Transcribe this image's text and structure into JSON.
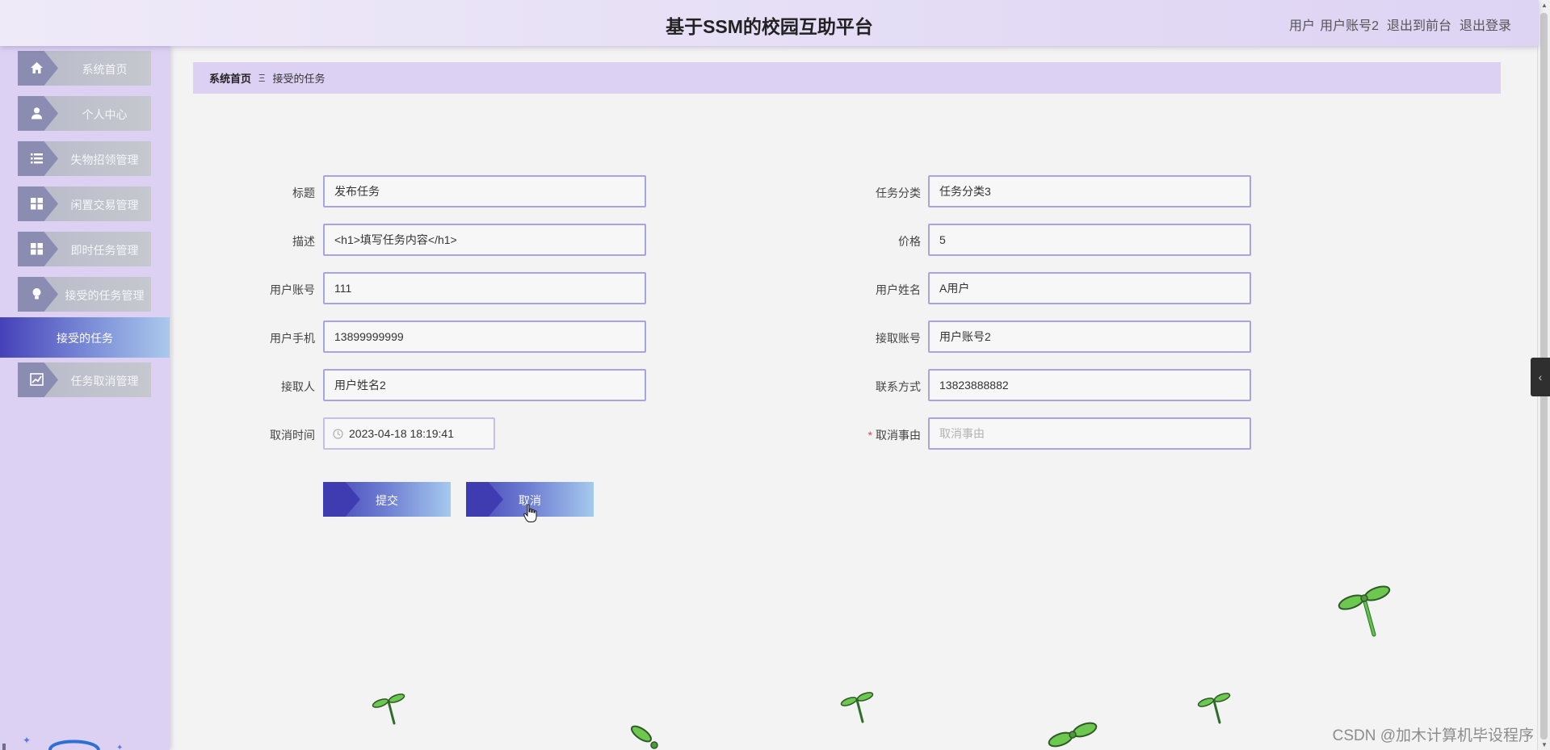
{
  "header": {
    "title": "基于SSM的校园互助平台",
    "user_role": "用户",
    "user_name": "用户账号2",
    "front_label": "退出到前台",
    "logout_label": "退出登录"
  },
  "sidebar": {
    "items": [
      {
        "label": "系统首页",
        "icon": "home-icon"
      },
      {
        "label": "个人中心",
        "icon": "user-icon"
      },
      {
        "label": "失物招领管理",
        "icon": "list-icon"
      },
      {
        "label": "闲置交易管理",
        "icon": "grid-icon"
      },
      {
        "label": "即时任务管理",
        "icon": "grid-icon"
      },
      {
        "label": "接受的任务管理",
        "icon": "bulb-icon"
      },
      {
        "label": "任务取消管理",
        "icon": "chart-icon"
      }
    ],
    "active_sub": "接受的任务"
  },
  "breadcrumb": {
    "home": "系统首页",
    "separator": "Ξ",
    "current": "接受的任务"
  },
  "form": {
    "title_label": "标题",
    "title_value": "发布任务",
    "category_label": "任务分类",
    "category_value": "任务分类3",
    "desc_label": "描述",
    "desc_value": "<h1>填写任务内容</h1>",
    "price_label": "价格",
    "price_value": "5",
    "account_label": "用户账号",
    "account_value": "111",
    "name_label": "用户姓名",
    "name_value": "A用户",
    "phone_label": "用户手机",
    "phone_value": "13899999999",
    "recv_account_label": "接取账号",
    "recv_account_value": "用户账号2",
    "receiver_label": "接取人",
    "receiver_value": "用户姓名2",
    "contact_label": "联系方式",
    "contact_value": "13823888882",
    "cancel_time_label": "取消时间",
    "cancel_time_value": "2023-04-18 18:19:41",
    "cancel_reason_label": "取消事由",
    "cancel_reason_placeholder": "取消事由",
    "required_mark": "*",
    "submit_label": "提交",
    "cancel_label": "取消"
  },
  "watermark": "CSDN @加木计算机毕设程序",
  "colors": {
    "header_bg": "#e6dff6",
    "sidebar_bg": "#dcd1f2",
    "active_gradient_start": "#4541b8",
    "active_gradient_end": "#aac9ec",
    "input_border": "#a7a3e5",
    "required": "#e0474b"
  }
}
